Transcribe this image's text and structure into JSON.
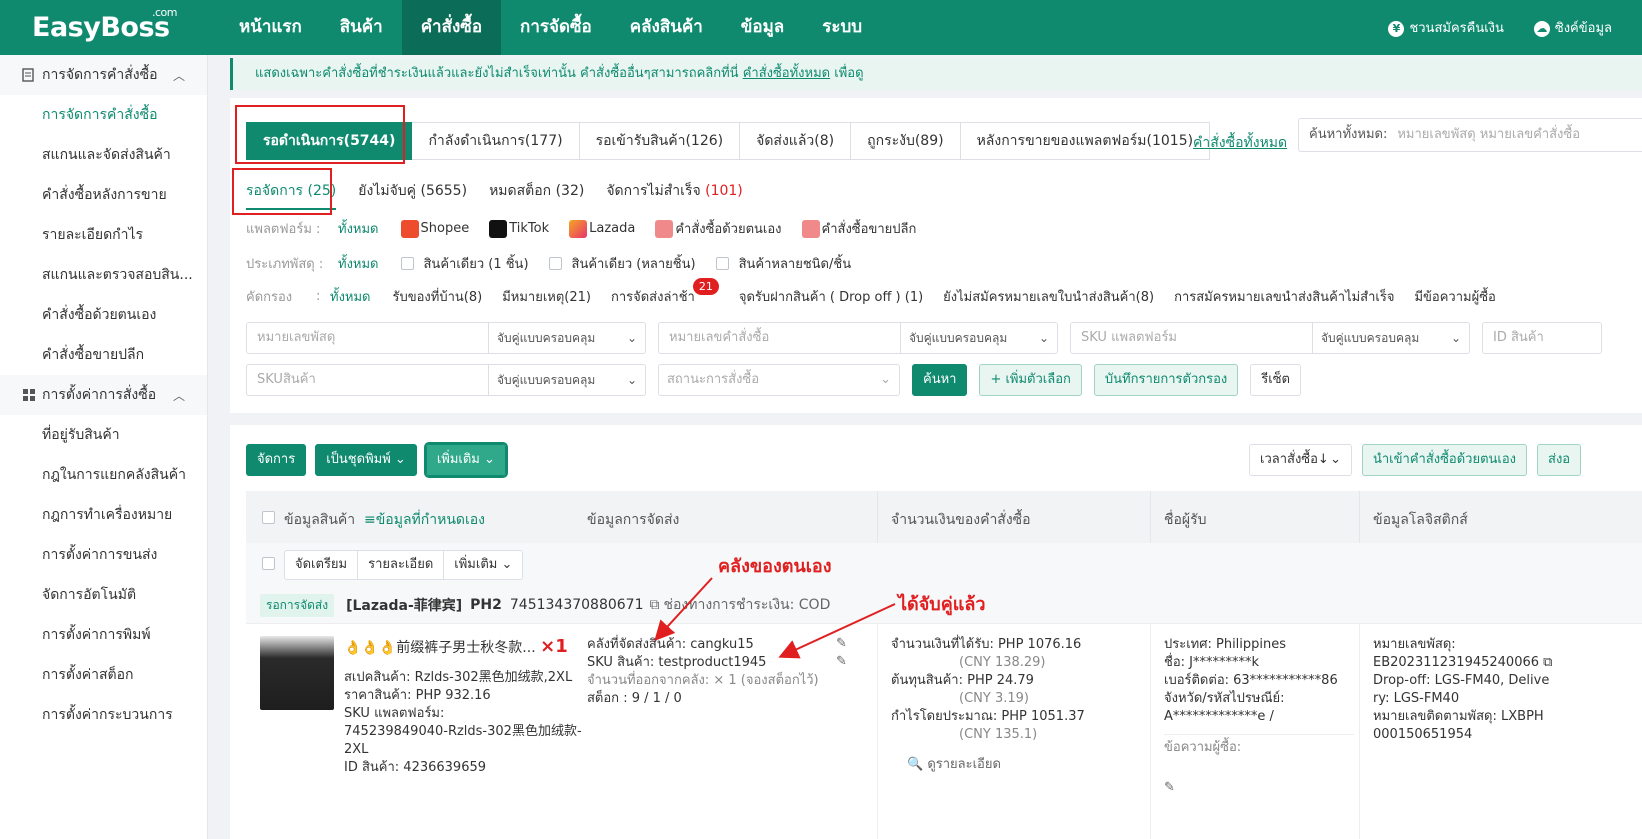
{
  "app": {
    "logo": "EasyBoss",
    "logo_sup": ".com"
  },
  "nav": {
    "items": [
      "หน้าแรก",
      "สินค้า",
      "คำสั่งซื้อ",
      "การจัดซื้อ",
      "คลังสินค้า",
      "ข้อมูล",
      "ระบบ"
    ],
    "active_index": 2,
    "referral": "ชวนสมัครคืนเงิน",
    "sync": "ซิงค์ข้อมูล"
  },
  "sidebar": {
    "group1": "การจัดการคำสั่งซื้อ",
    "group1_items": [
      "การจัดการคำสั่งซื้อ",
      "สแกนและจัดส่งสินค้า",
      "คำสั่งซื้อหลังการขาย",
      "รายละเอียดกำไร",
      "สแกนและตรวจสอบสิน...",
      "คำสั่งซื้อด้วยตนเอง",
      "คำสั่งซื้อขายปลีก"
    ],
    "group2": "การตั้งค่าการสั่งซื้อ",
    "group2_items": [
      "ที่อยู่รับสินค้า",
      "กฎในการแยกคลังสินค้า",
      "กฎการทำเครื่องหมาย",
      "การตั้งค่าการขนส่ง",
      "จัดการอัตโนมัติ",
      "การตั้งค่าการพิมพ์",
      "การตั้งค่าสต็อก",
      "การตั้งค่ากระบวนการ"
    ]
  },
  "notice": {
    "text": "แสดงเฉพาะคำสั่งซื้อที่ชำระเงินแล้วและยังไม่สำเร็จเท่านั้น คำสั่งซื้ออื่นๆสามารถคลิกที่นี่ ",
    "link": "คำสั่งซื้อทั้งหมด",
    "tail": " เพื่อดู"
  },
  "status_tabs": [
    "รอดำเนินการ(5744)",
    "กำลังดำเนินการ(177)",
    "รอเข้ารับสินค้า(126)",
    "จัดส่งแล้ว(8)",
    "ถูกระงับ(89)",
    "หลังการขายของแพลตฟอร์ม(1015)"
  ],
  "all_orders_link": "คำสั่งซื้อทั้งหมด",
  "search": {
    "label": "ค้นหาทั้งหมด:",
    "placeholder": "หมายเลขพัสดุ หมายเลขคำสั่งซื้อ"
  },
  "sub_tabs": {
    "t1": "รอจัดการ (25)",
    "t2": "ยังไม่จับคู่ (5655)",
    "t3": "หมดสต็อก (32)",
    "t4_label": "จัดการไม่สำเร็จ ",
    "t4_count": "(101)"
  },
  "filters": {
    "platform_label": "แพลตฟอร์ม :",
    "platform_all": "ทั้งหมด",
    "platforms": [
      "Shopee",
      "TikTok",
      "Lazada",
      "คำสั่งซื้อด้วยตนเอง",
      "คำสั่งซื้อขายปลีก"
    ],
    "parcel_label": "ประเภทพัสดุ :",
    "parcel_all": "ทั้งหมด",
    "parcel_opts": [
      "สินค้าเดียว (1 ชิ้น)",
      "สินค้าเดียว (หลายชิ้น)",
      "สินค้าหลายชนิด/ชิ้น"
    ],
    "screen_label": "คัดกรอง",
    "screen_colon": ":",
    "screen_all": "ทั้งหมด",
    "screen_opts": [
      "รับของที่บ้าน(8)",
      "มีหมายเหตุ(21)",
      "การจัดส่งล่าช้า",
      "จุดรับฝากสินค้า ( Drop off ) (1)",
      "ยังไม่สมัครหมายเลขใบนำส่งสินค้า(8)",
      "การสมัครหมายเลขนำส่งสินค้าไม่สำเร็จ",
      "มีข้อความผู้ซื้อ"
    ],
    "late_badge": "21"
  },
  "inputs": {
    "parcel_no": "หมายเลขพัสดุ",
    "order_no": "หมายเลขคำสั่งซื้อ",
    "platform_sku": "SKU แพลตฟอร์ม",
    "product_id": "ID สินค้า",
    "sku": "SKUสินค้า",
    "order_status": "สถานะการสั่งซื้อ",
    "match_mode": "จับคู่แบบครอบคลุม",
    "search_btn": "ค้นหา",
    "add_filter_btn": "+ เพิ่มตัวเลือก",
    "save_filter_btn": "บันทึกรายการตัวกรอง",
    "reset_btn": "รีเซ็ต"
  },
  "actions": {
    "manage": "จัดการ",
    "print_batch": "เป็นชุดพิมพ์",
    "more": "เพิ่มเติม",
    "sort": "เวลาสั่งซื้อ↓",
    "import_manual": "นำเข้าคำสั่งซื้อด้วยตนเอง",
    "send_partial": "ส่งอ"
  },
  "table_headers": {
    "product": "ข้อมูลสินค้า",
    "custom": "ข้อมูลที่กำหนดเอง",
    "shipping": "ข้อมูลการจัดส่ง",
    "amount": "จำนวนเงินของคำสั่งซื้อ",
    "receiver": "ชื่อผู้รับ",
    "logistics": "ข้อมูลโลจิสติกส์"
  },
  "row_actions": [
    "จัดเตรียม",
    "รายละเอียด",
    "เพิ่มเติม"
  ],
  "order": {
    "status_tag": "รอการจัดส่ง",
    "store": "[Lazada-菲律宾]",
    "shop_code": "PH2",
    "order_id": "745134370880671",
    "payment": "ช่องทางการชำระเงิน:  COD",
    "product_title": "👌👌👌前缀裤子男士秋冬款...",
    "qty": "×1",
    "spec": "สเปคสินค้า:  Rzlds-302黑色加绒款,2XL",
    "price": "ราคาสินค้า:  PHP 932.16",
    "platform_sku_label": "SKU แพลตฟอร์ม:",
    "platform_sku_1": "745239849040-Rzlds-302黑色加绒款-",
    "platform_sku_2": "2XL",
    "product_id": "ID สินค้า:  4236639659",
    "warehouse": "คลังที่จัดส่งสินค้า:  cangku15",
    "sku": "SKU สินค้า:  testproduct1945",
    "out_qty": "จำนวนที่ออกจากคลัง:  ×  1  (จองสต็อกไว้)",
    "stock": "สต็อก    :  9 / 1 / 0",
    "received": "จำนวนเงินที่ได้รับ:  PHP 1076.16",
    "received_cny": "(CNY 138.29)",
    "cost": "ต้นทุนสินค้า:  PHP 24.79",
    "cost_cny": "(CNY 3.19)",
    "profit": "กำไรโดยประมาณ:  PHP 1051.37",
    "profit_cny": "(CNY 135.1)",
    "detail_link": "ดูรายละเอียด",
    "country": "ประเทศ:  Philippines",
    "name": "ชื่อ:  J*********k",
    "phone": "เบอร์ติดต่อ:  63***********86",
    "province_label": "จังหวัด/รหัสไปรษณีย์:",
    "province": "A*************e /",
    "buyer_msg": "ข้อความผู้ซื้อ:",
    "tracking_label": "หมายเลขพัสดุ:",
    "tracking": "EB202311231945240066",
    "dropoff_1": "Drop-off: LGS-FM40, Delive",
    "dropoff_2": "ry: LGS-FM40",
    "track_no_label": "หมายเลขติดตามพัสดุ:  LXBPH",
    "track_no_2": "000150651954"
  },
  "annotations": {
    "own_warehouse": "คลังของตนเอง",
    "matched": "ได้จับคู่แล้ว"
  },
  "colors": {
    "brand": "#0f8a6f",
    "annotation": "#e02020"
  }
}
